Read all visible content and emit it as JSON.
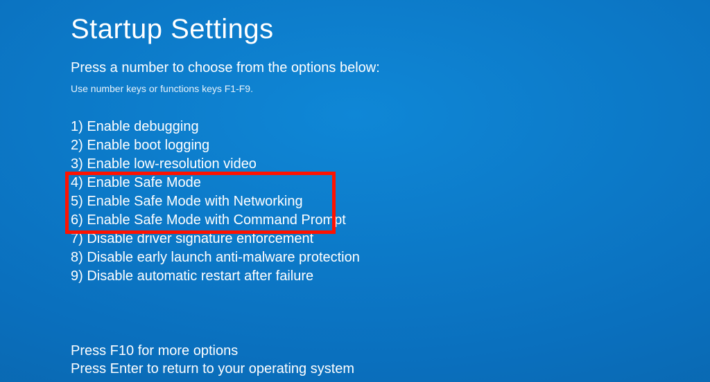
{
  "title": "Startup Settings",
  "subtitle": "Press a number to choose from the options below:",
  "hint": "Use number keys or functions keys F1-F9.",
  "options": [
    {
      "num": "1",
      "label": "Enable debugging"
    },
    {
      "num": "2",
      "label": "Enable boot logging"
    },
    {
      "num": "3",
      "label": "Enable low-resolution video"
    },
    {
      "num": "4",
      "label": "Enable Safe Mode"
    },
    {
      "num": "5",
      "label": "Enable Safe Mode with Networking"
    },
    {
      "num": "6",
      "label": "Enable Safe Mode with Command Prompt"
    },
    {
      "num": "7",
      "label": "Disable driver signature enforcement"
    },
    {
      "num": "8",
      "label": "Disable early launch anti-malware protection"
    },
    {
      "num": "9",
      "label": "Disable automatic restart after failure"
    }
  ],
  "footer_more": "Press F10 for more options",
  "footer_return": "Press Enter to return to your operating system",
  "highlight": {
    "start_index": 3,
    "end_index": 5,
    "color": "#ff1200"
  }
}
